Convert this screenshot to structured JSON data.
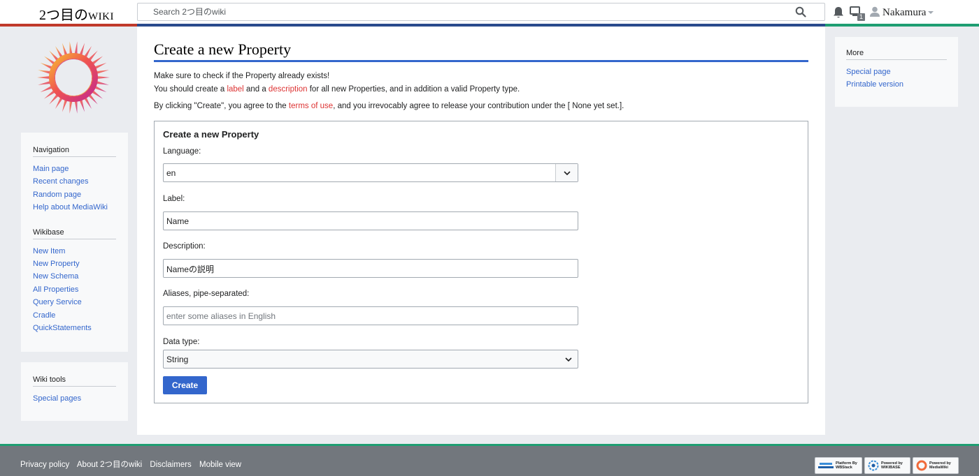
{
  "header": {
    "site_name": "2つ目の",
    "site_suffix": "WIKI",
    "search_placeholder": "Search 2つ目のwiki",
    "notification_count": "1",
    "username": "Nakamura",
    "icons": [
      "bell-icon",
      "devices-icon",
      "user-icon",
      "search-icon"
    ]
  },
  "sidebar": {
    "navigation": {
      "title": "Navigation",
      "items": [
        "Main page",
        "Recent changes",
        "Random page",
        "Help about MediaWiki"
      ]
    },
    "wikibase": {
      "title": "Wikibase",
      "items": [
        "New Item",
        "New Property",
        "New Schema",
        "All Properties",
        "Query Service",
        "Cradle",
        "QuickStatements"
      ]
    },
    "tools": {
      "title": "Wiki tools",
      "items": [
        "Special pages"
      ]
    }
  },
  "right_sidebar": {
    "title": "More",
    "items": [
      "Special page",
      "Printable version"
    ]
  },
  "page": {
    "title": "Create a new Property",
    "intro_line1": "Make sure to check if the Property already exists!",
    "intro_line2_a": "You should create a ",
    "intro_link_label": "label",
    "intro_line2_b": " and a ",
    "intro_link_description": "description",
    "intro_line2_c": " for all new Properties, and in addition a valid Property type.",
    "agree_a": "By clicking \"Create\", you agree to the ",
    "agree_link": "terms of use",
    "agree_b": ", and you irrevocably agree to release your contribution under the [ None yet set.]."
  },
  "form": {
    "legend": "Create a new Property",
    "language_label": "Language:",
    "language_value": "en",
    "label_label": "Label:",
    "label_value": "Name",
    "description_label": "Description:",
    "description_value": "Nameの説明",
    "aliases_label": "Aliases, pipe-separated:",
    "aliases_placeholder": "enter some aliases in English",
    "datatype_label": "Data type:",
    "datatype_value": "String",
    "submit_label": "Create"
  },
  "footer": {
    "links": [
      "Privacy policy",
      "About 2つ目のwiki",
      "Disclaimers",
      "Mobile view"
    ],
    "badges": [
      {
        "line1": "Platform By",
        "line2": "WBStack"
      },
      {
        "line1": "Powered by",
        "line2": "WIKIBASE"
      },
      {
        "line1": "Powered by",
        "line2": "MediaWiki"
      }
    ]
  },
  "colors": {
    "link": "#3366cc",
    "redlink": "#dd3333",
    "accent_red": "#c0392b",
    "accent_blue": "#2a4b8d",
    "accent_green": "#1e9e72",
    "footer_bg": "#72777d"
  }
}
